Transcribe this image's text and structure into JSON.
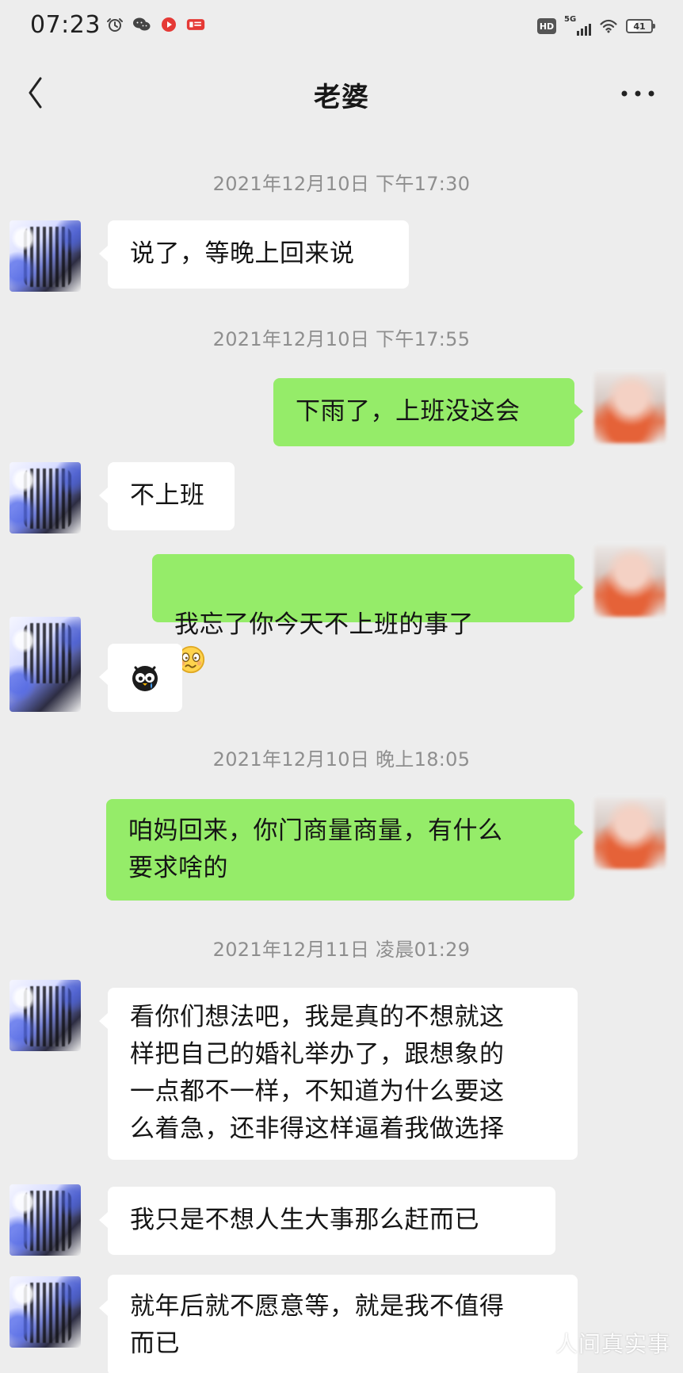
{
  "status_bar": {
    "time": "07:23",
    "left_icons": [
      "alarm-icon",
      "wechat-icon",
      "record-icon",
      "news-app-icon"
    ],
    "right_icons": [
      "hd-icon",
      "signal-5g-icon",
      "wifi-icon",
      "battery-icon"
    ],
    "hd_label": "HD",
    "network_label": "5G",
    "battery_level": "41"
  },
  "header": {
    "title": "老婆",
    "back_icon": "chevron-left-icon",
    "more_icon": "more-dots-icon"
  },
  "messages": [
    {
      "timestamp": "2021年12月10日 下午17:30"
    },
    {
      "side": "left",
      "text": "说了，等晚上回来说"
    },
    {
      "timestamp": "2021年12月10日 下午17:55"
    },
    {
      "side": "right",
      "text": "下雨了，上班没这会"
    },
    {
      "side": "left",
      "text": "不上班"
    },
    {
      "side": "right",
      "text": "我忘了你今天不上班的事了",
      "emoji": "embarrassed-emoji-icon"
    },
    {
      "side": "left",
      "sticker": "crying-bird-sticker-icon"
    },
    {
      "timestamp": "2021年12月10日 晚上18:05"
    },
    {
      "side": "right",
      "text": "咱妈回来，你门商量商量，有什么\n要求啥的"
    },
    {
      "timestamp": "2021年12月11日 凌晨01:29"
    },
    {
      "side": "left",
      "text": "看你们想法吧，我是真的不想就这\n样把自己的婚礼举办了，跟想象的\n一点都不一样，不知道为什么要这\n么着急，还非得这样逼着我做选择"
    },
    {
      "side": "left",
      "text": "我只是不想人生大事那么赶而已"
    },
    {
      "side": "left",
      "text": "就年后就不愿意等，就是我不值得\n而已"
    }
  ],
  "watermark": "人间真实事",
  "colors": {
    "background": "#ededed",
    "incoming_bubble": "#ffffff",
    "outgoing_bubble": "#95ec69",
    "timestamp_text": "#8e8e8e"
  }
}
